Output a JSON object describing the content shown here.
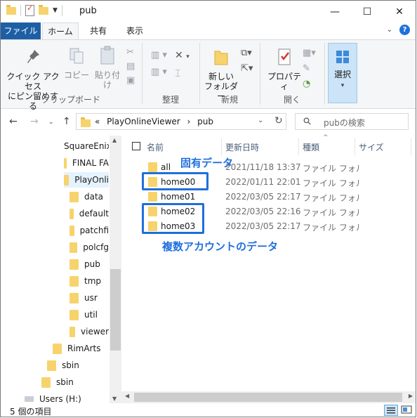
{
  "window": {
    "title": "pub",
    "minimize": "—",
    "maximize": "☐",
    "close": "✕"
  },
  "ribbon_tabs": {
    "file": "ファイル",
    "home": "ホーム",
    "share": "共有",
    "view": "表示"
  },
  "ribbon": {
    "pin_quick_access": "クイック アクセス\nにピン留めする",
    "copy": "コピー",
    "paste": "貼り付け",
    "clipboard_group": "クリップボード",
    "organize_group": "整理",
    "new_folder": "新しい\nフォルダー",
    "new_group": "新規",
    "properties": "プロパティ",
    "open_group": "開く",
    "select": "選択"
  },
  "address": {
    "overflow": "«",
    "crumbs": [
      "PlayOnlineViewer",
      "pub"
    ],
    "separator": "›",
    "search_placeholder": "pubの検索"
  },
  "nav": {
    "items": [
      "SquareEnix",
      "FINAL FA",
      "PlayOnli",
      "data",
      "default",
      "patchfi",
      "polcfg",
      "pub",
      "tmp",
      "usr",
      "util",
      "viewer",
      "RimArts",
      "sbin",
      "sbin",
      "Users (H:)"
    ]
  },
  "columns": {
    "name": "名前",
    "date": "更新日時",
    "type": "種類",
    "size": "サイズ"
  },
  "files": [
    {
      "name": "all",
      "date": "2021/11/18 13:37",
      "type": "ファイル フォルダー"
    },
    {
      "name": "home00",
      "date": "2022/01/11 22:01",
      "type": "ファイル フォルダー"
    },
    {
      "name": "home01",
      "date": "2022/03/05 22:17",
      "type": "ファイル フォルダー"
    },
    {
      "name": "home02",
      "date": "2022/03/05 22:16",
      "type": "ファイル フォルダー"
    },
    {
      "name": "home03",
      "date": "2022/03/05 22:17",
      "type": "ファイル フォルダー"
    }
  ],
  "annotations": {
    "unique_data": "固有データ",
    "multi_account_data": "複数アカウントのデータ"
  },
  "status": {
    "item_count": "5 個の項目"
  },
  "colors": {
    "accent": "#1f6fdc",
    "file_tab": "#1d5fa5",
    "folder": "#f6d36d"
  }
}
